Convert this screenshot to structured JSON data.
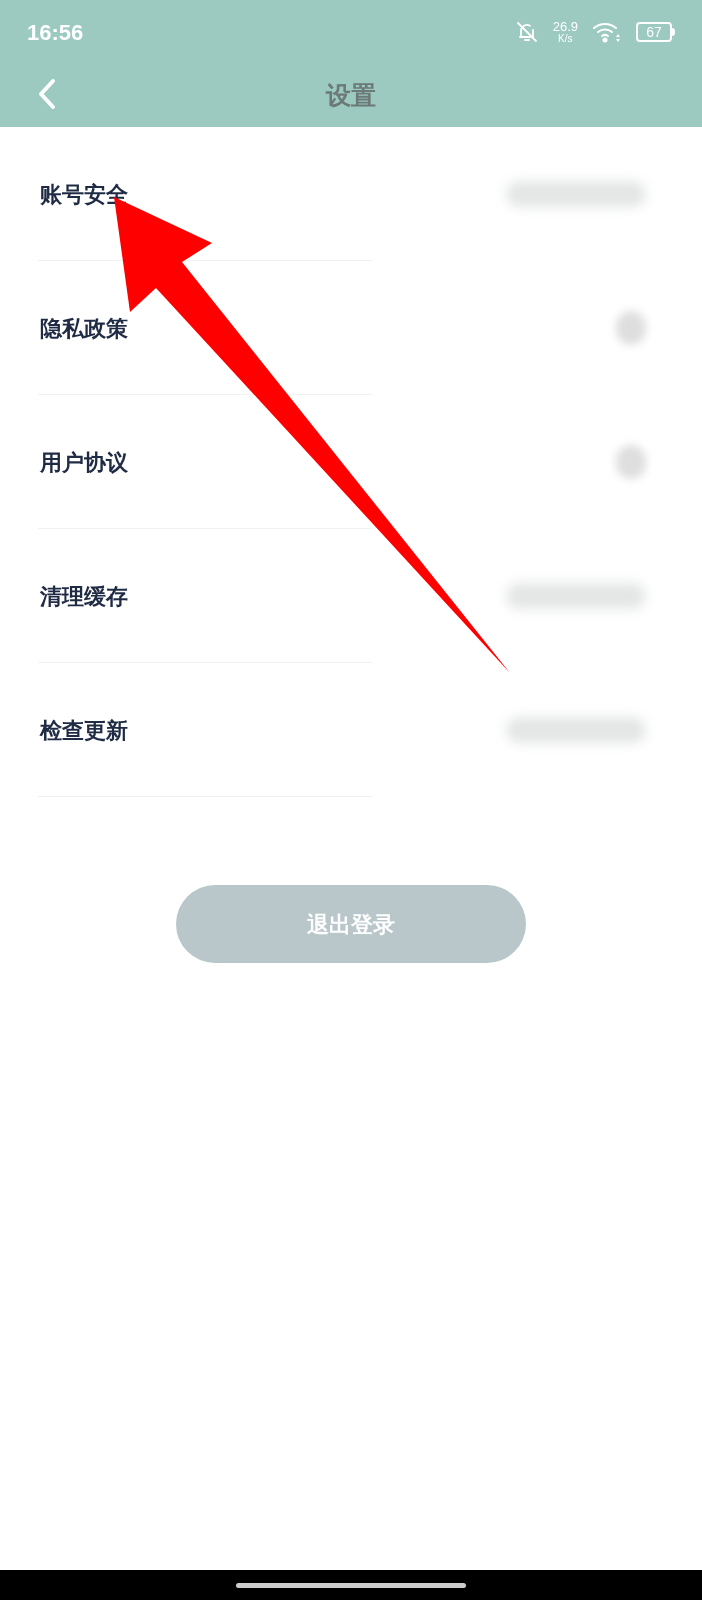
{
  "status_bar": {
    "time": "16:56",
    "net_speed": "26.9",
    "net_unit": "K/s",
    "battery": "67"
  },
  "header": {
    "title": "设置"
  },
  "items": [
    {
      "label": "账号安全",
      "kind": "wide"
    },
    {
      "label": "隐私政策",
      "kind": "dot"
    },
    {
      "label": "用户协议",
      "kind": "dot"
    },
    {
      "label": "清理缓存",
      "kind": "wide"
    },
    {
      "label": "检查更新",
      "kind": "wide"
    }
  ],
  "logout_button": {
    "label": "退出登录",
    "disabled": true
  }
}
